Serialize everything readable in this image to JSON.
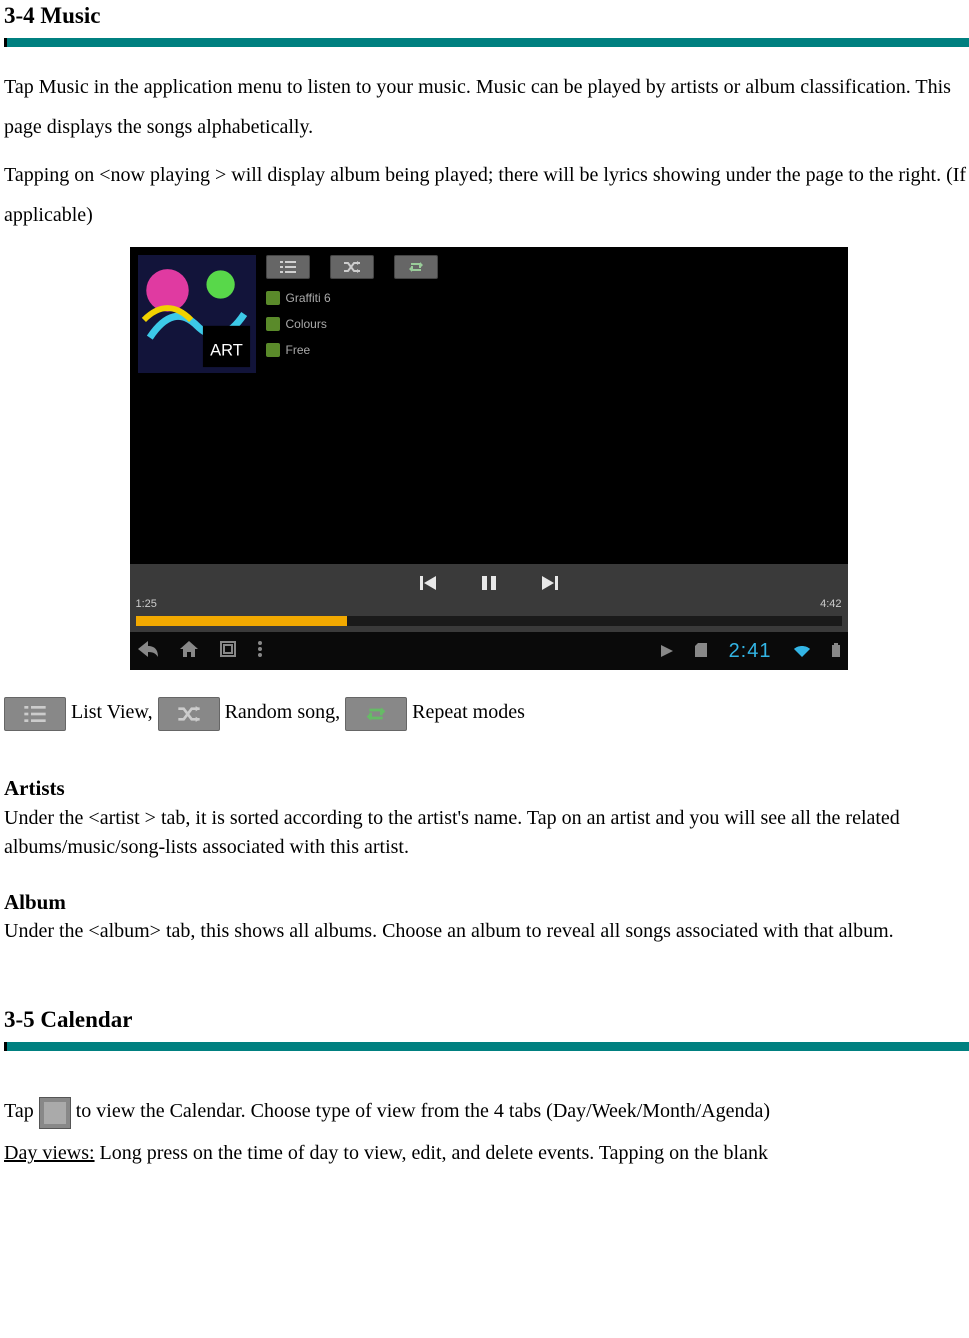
{
  "section1": {
    "heading": "3-4 Music",
    "para1": "Tap Music in the application menu to listen to your music. Music can be played by artists or album classification. This page displays the songs alphabetically.",
    "para2": "Tapping on <now playing > will display album being played; there will be lyrics showing under the page to the right. (If applicable)"
  },
  "player": {
    "tracks": [
      "Graffiti 6",
      "Colours",
      "Free"
    ],
    "time_elapsed": "1:25",
    "time_total": "4:42",
    "clock": "2:41"
  },
  "legend": {
    "list_view": " List View, ",
    "random_song": " Random song, ",
    "repeat_modes": " Repeat modes"
  },
  "artists": {
    "heading": "Artists",
    "body": "Under the <artist > tab, it is sorted according to the artist's name. Tap on an artist and you will see all the related albums/music/song-lists associated with this artist."
  },
  "album": {
    "heading": "Album",
    "body": "Under the <album> tab, this shows all albums.   Choose an album to reveal all songs associated with that album."
  },
  "section2": {
    "heading": "3-5 Calendar",
    "para1_pre": "Tap ",
    "para1_post": " to view the Calendar.   Choose type of view from the 4 tabs (Day/Week/Month/Agenda)",
    "day_views_label": "Day views:",
    "day_views_body": " Long press on the time of day to view, edit, and delete events.   Tapping on the blank"
  }
}
